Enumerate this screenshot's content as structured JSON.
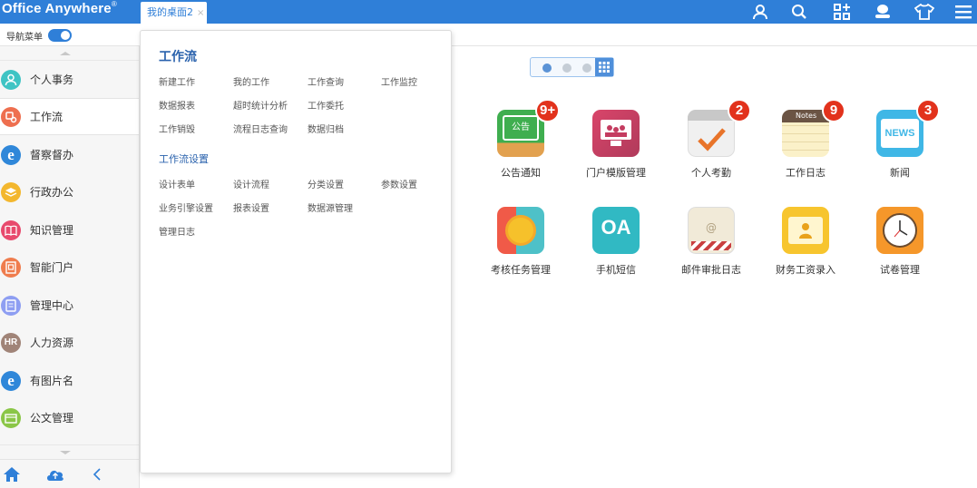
{
  "app": {
    "logo_text": "Office Anywhere",
    "logo_mark": "®"
  },
  "tabs": [
    {
      "label": "我的桌面2",
      "close": "×"
    }
  ],
  "top_icons": [
    "user-icon",
    "search-icon",
    "apps-grid-icon",
    "chat-icon",
    "theme-shirt-icon",
    "menu-icon"
  ],
  "subbar": {
    "nav_toggle_label": "导航菜单",
    "nav_toggle_on": true
  },
  "sidebar": {
    "items": [
      {
        "label": "个人事务",
        "icon": "person-icon",
        "color": "#3fc4c4"
      },
      {
        "label": "工作流",
        "icon": "workflow-icon",
        "color": "#ee6f4f",
        "active": true
      },
      {
        "label": "督察督办",
        "icon": "ie-icon",
        "color": "#2f87d9"
      },
      {
        "label": "行政办公",
        "icon": "admin-icon",
        "color": "#f3b72e"
      },
      {
        "label": "知识管理",
        "icon": "book-icon",
        "color": "#e84a6d"
      },
      {
        "label": "智能门户",
        "icon": "portal-icon",
        "color": "#ef7c4d"
      },
      {
        "label": "管理中心",
        "icon": "manage-icon",
        "color": "#8e9ef2"
      },
      {
        "label": "人力资源",
        "icon": "hr-icon",
        "color": "#a08478",
        "text": "HR"
      },
      {
        "label": "有图片名",
        "icon": "ie-icon",
        "color": "#2f87d9"
      },
      {
        "label": "公文管理",
        "icon": "document-icon",
        "color": "#8ac647"
      }
    ]
  },
  "panel": {
    "title": "工作流",
    "links_group1": [
      [
        "新建工作",
        "我的工作",
        "工作查询",
        "工作监控"
      ],
      [
        "数据报表",
        "超时统计分析",
        "工作委托"
      ],
      [
        "工作销毁",
        "流程日志查询",
        "数据归档"
      ]
    ],
    "subtitle": "工作流设置",
    "links_group2": [
      [
        "设计表单",
        "设计流程",
        "分类设置",
        "参数设置"
      ],
      [
        "业务引擎设置",
        "报表设置",
        "数据源管理"
      ],
      [
        "管理日志"
      ]
    ]
  },
  "desktop": {
    "pager": {
      "pages": 3,
      "current": 1
    },
    "apps": [
      {
        "label": "公告通知",
        "icon": "notice-board-icon",
        "badge": "9+",
        "glyph": "公告"
      },
      {
        "label": "门户模版管理",
        "icon": "portal-template-icon",
        "badge": ""
      },
      {
        "label": "个人考勤",
        "icon": "calendar-check-icon",
        "badge": "2"
      },
      {
        "label": "工作日志",
        "icon": "notes-icon",
        "badge": "9",
        "glyph": "Notes"
      },
      {
        "label": "新闻",
        "icon": "news-icon",
        "badge": "3",
        "glyph": "NEWS"
      },
      {
        "label": "考核任务管理",
        "icon": "medal-icon",
        "badge": ""
      },
      {
        "label": "手机短信",
        "icon": "oa-sms-icon",
        "badge": "",
        "glyph": "OA"
      },
      {
        "label": "邮件审批日志",
        "icon": "mail-icon",
        "badge": "",
        "glyph": "@"
      },
      {
        "label": "财务工资录入",
        "icon": "payroll-icon",
        "badge": ""
      },
      {
        "label": "试卷管理",
        "icon": "clock-icon",
        "badge": ""
      }
    ]
  }
}
